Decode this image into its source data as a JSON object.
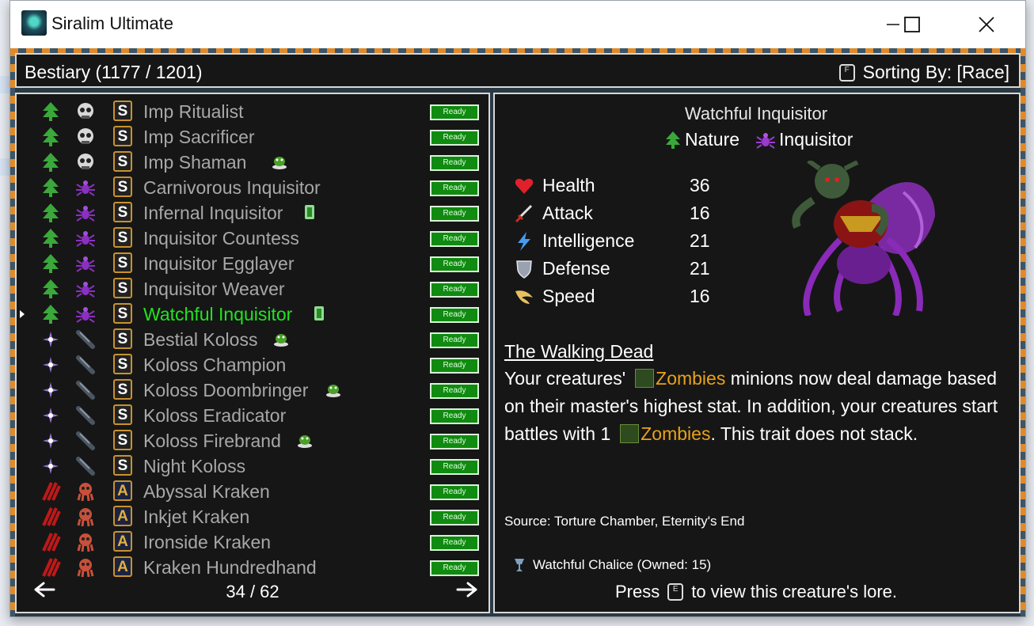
{
  "window": {
    "title": "Siralim Ultimate"
  },
  "header": {
    "title": "Bestiary (1177 / 1201)",
    "sort_key": "F",
    "sort_label": "Sorting By: [Race]"
  },
  "list": {
    "ready_label": "Ready",
    "rows": [
      {
        "name": "Imp Ritualist",
        "class": "nature",
        "race": "imp",
        "book": "S",
        "badge": null,
        "selected": false
      },
      {
        "name": "Imp Sacrificer",
        "class": "nature",
        "race": "imp",
        "book": "S",
        "badge": null,
        "selected": false
      },
      {
        "name": "Imp Shaman",
        "class": "nature",
        "race": "imp",
        "book": "S",
        "badge": "slime",
        "selected": false
      },
      {
        "name": "Carnivorous Inquisitor",
        "class": "nature",
        "race": "inquisitor",
        "book": "S",
        "badge": null,
        "selected": false
      },
      {
        "name": "Infernal Inquisitor",
        "class": "nature",
        "race": "inquisitor",
        "book": "S",
        "badge": "card",
        "selected": false
      },
      {
        "name": "Inquisitor Countess",
        "class": "nature",
        "race": "inquisitor",
        "book": "S",
        "badge": null,
        "selected": false
      },
      {
        "name": "Inquisitor Egglayer",
        "class": "nature",
        "race": "inquisitor",
        "book": "S",
        "badge": null,
        "selected": false
      },
      {
        "name": "Inquisitor Weaver",
        "class": "nature",
        "race": "inquisitor",
        "book": "S",
        "badge": null,
        "selected": false
      },
      {
        "name": "Watchful Inquisitor",
        "class": "nature",
        "race": "inquisitor",
        "book": "S",
        "badge": "card",
        "selected": true
      },
      {
        "name": "Bestial Koloss",
        "class": "sorcery",
        "race": "koloss",
        "book": "S",
        "badge": "slime",
        "selected": false
      },
      {
        "name": "Koloss Champion",
        "class": "sorcery",
        "race": "koloss",
        "book": "S",
        "badge": null,
        "selected": false
      },
      {
        "name": "Koloss Doombringer",
        "class": "sorcery",
        "race": "koloss",
        "book": "S",
        "badge": "slime",
        "selected": false
      },
      {
        "name": "Koloss Eradicator",
        "class": "sorcery",
        "race": "koloss",
        "book": "S",
        "badge": null,
        "selected": false
      },
      {
        "name": "Koloss Firebrand",
        "class": "sorcery",
        "race": "koloss",
        "book": "S",
        "badge": "slime",
        "selected": false
      },
      {
        "name": "Night Koloss",
        "class": "sorcery",
        "race": "koloss",
        "book": "S",
        "badge": null,
        "selected": false
      },
      {
        "name": "Abyssal Kraken",
        "class": "chaos",
        "race": "kraken",
        "book": "A",
        "badge": null,
        "selected": false
      },
      {
        "name": "Inkjet Kraken",
        "class": "chaos",
        "race": "kraken",
        "book": "A",
        "badge": null,
        "selected": false
      },
      {
        "name": "Ironside Kraken",
        "class": "chaos",
        "race": "kraken",
        "book": "A",
        "badge": null,
        "selected": false
      },
      {
        "name": "Kraken Hundredhand",
        "class": "chaos",
        "race": "kraken",
        "book": "A",
        "badge": null,
        "selected": false
      }
    ],
    "page": "34 / 62"
  },
  "detail": {
    "name": "Watchful Inquisitor",
    "class_label": "Nature",
    "race_label": "Inquisitor",
    "stats": [
      {
        "label": "Health",
        "value": "36",
        "icon": "heart-icon"
      },
      {
        "label": "Attack",
        "value": "16",
        "icon": "sword-icon"
      },
      {
        "label": "Intelligence",
        "value": "21",
        "icon": "lightning-icon"
      },
      {
        "label": "Defense",
        "value": "21",
        "icon": "shield-icon"
      },
      {
        "label": "Speed",
        "value": "16",
        "icon": "wing-icon"
      }
    ],
    "trait_name": "The Walking Dead",
    "trait_parts": {
      "p1": "Your creatures'",
      "z1": "Zombies",
      "p2": " minions now deal damage based on their master's highest stat. In addition, your creatures start battles with 1",
      "z2": "Zombies",
      "p3": ". This trait does not stack."
    },
    "source": "Source: Torture Chamber, Eternity's End",
    "artifact": "Watchful Chalice (Owned: 15)",
    "press_before": "Press",
    "press_key": "E",
    "press_after": "to view this creature's lore."
  },
  "colors": {
    "selected": "#21e321",
    "ready_bg": "#108a10",
    "zombies": "#e8a21a",
    "panel_bg": "#161616"
  }
}
